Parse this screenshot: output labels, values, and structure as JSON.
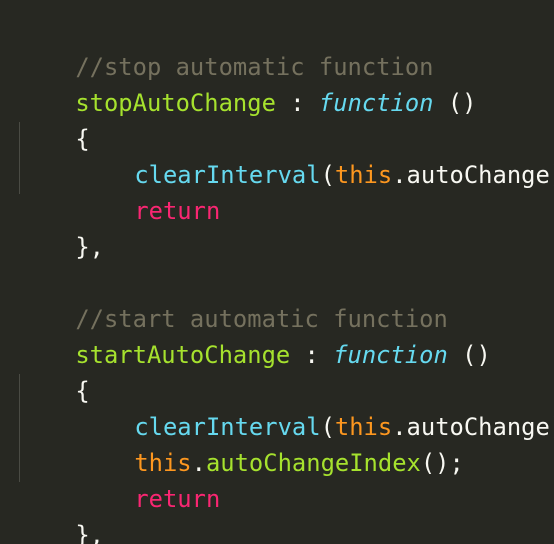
{
  "editor": {
    "theme_colors": {
      "background": "#272822",
      "comment": "#75715e",
      "function_name": "#a6e22e",
      "storage": "#66d9ef",
      "this": "#fd971f",
      "keyword": "#f92672",
      "text": "#f8f8f2"
    },
    "block1": {
      "comment": "//stop automatic function",
      "name": "stopAutoChange",
      "sep": " : ",
      "keyword": "function",
      "params": " ()",
      "open_brace": "{",
      "call1_fn": "clearInterval",
      "call1_paren_open": "(",
      "call1_this": "this",
      "call1_member": ".autoChange",
      "call1_end": ");",
      "return_kw": "return",
      "close": "},"
    },
    "block2": {
      "comment": "//start automatic function",
      "name": "startAutoChange",
      "sep": " : ",
      "keyword": "function",
      "params": " ()",
      "open_brace": "{",
      "call1_fn": "clearInterval",
      "call1_paren_open": "(",
      "call1_this": "this",
      "call1_member": ".autoChange",
      "call1_end": ");",
      "call2_this": "this",
      "call2_dot": ".",
      "call2_fn": "autoChangeIndex",
      "call2_end": "();",
      "return_kw": "return",
      "close": "},"
    }
  }
}
